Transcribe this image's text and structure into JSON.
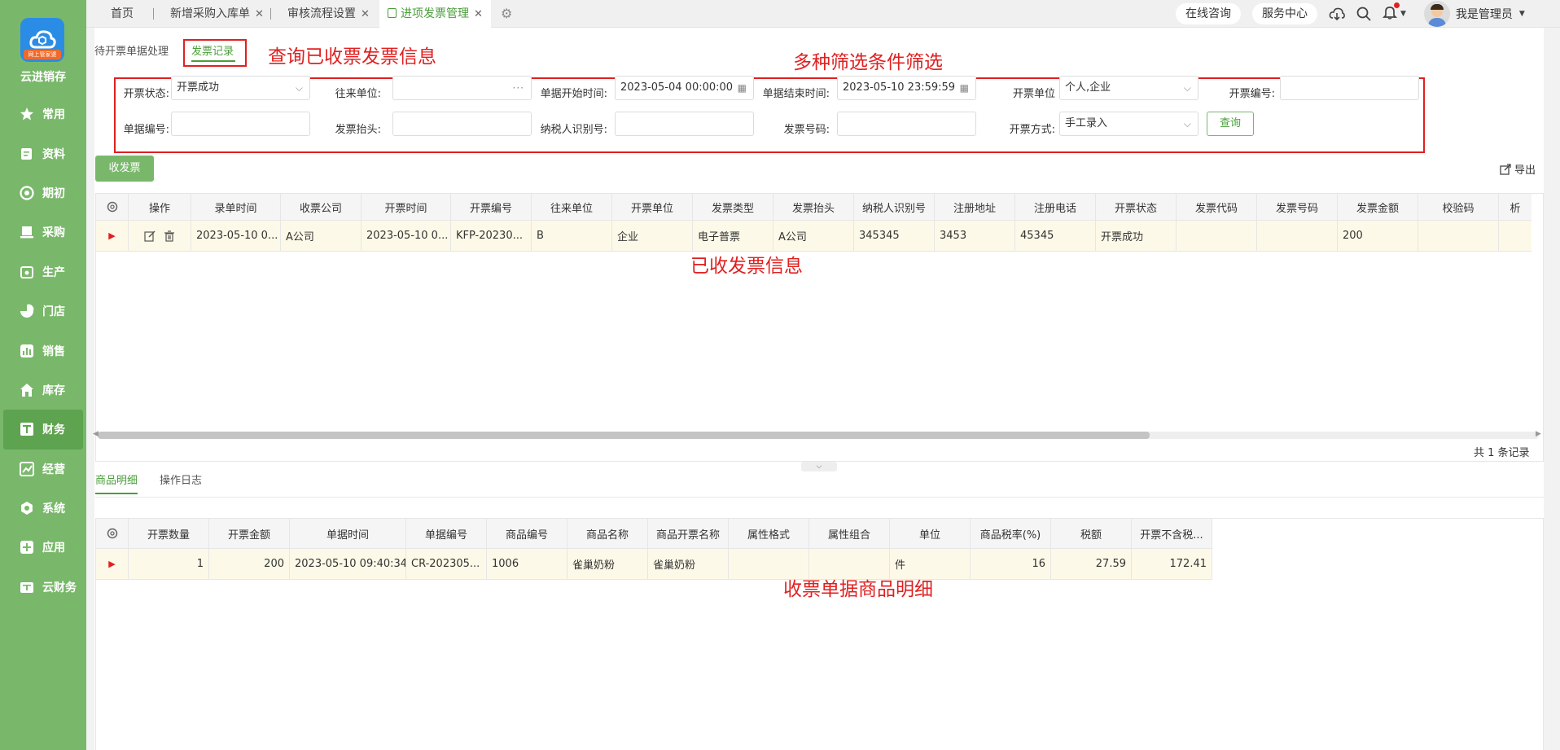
{
  "sidebar": {
    "logo_badge": "网上管家婆",
    "brand": "云进销存",
    "items": [
      {
        "label": "常用",
        "icon": "star-icon"
      },
      {
        "label": "资料",
        "icon": "document-icon"
      },
      {
        "label": "期初",
        "icon": "target-icon"
      },
      {
        "label": "采购",
        "icon": "purchase-icon"
      },
      {
        "label": "生产",
        "icon": "production-icon"
      },
      {
        "label": "门店",
        "icon": "pie-icon"
      },
      {
        "label": "销售",
        "icon": "bar-chart-icon"
      },
      {
        "label": "库存",
        "icon": "home-icon"
      },
      {
        "label": "财务",
        "icon": "finance-icon",
        "active": true
      },
      {
        "label": "经营",
        "icon": "trend-icon"
      },
      {
        "label": "系统",
        "icon": "gear-icon"
      },
      {
        "label": "应用",
        "icon": "plus-icon"
      },
      {
        "label": "云财务",
        "icon": "cloud-finance-icon"
      }
    ]
  },
  "topbar": {
    "tabs": [
      "首页",
      "新增采购入库单",
      "审核流程设置",
      "进项发票管理"
    ],
    "consult": "在线咨询",
    "service": "服务中心",
    "user": "我是管理员"
  },
  "subtabs": {
    "pending": "待开票单据处理",
    "records": "发票记录"
  },
  "annotations": {
    "a1": "查询已收票发票信息",
    "a2": "多种筛选条件筛选",
    "a3": "已收发票信息",
    "a4": "收票单据商品明细"
  },
  "filters": {
    "status_label": "开票状态:",
    "status_value": "开票成功",
    "partner_label": "往来单位:",
    "start_label": "单据开始时间:",
    "start_value": "2023-05-04 00:00:00",
    "end_label": "单据结束时间:",
    "end_value": "2023-05-10 23:59:59",
    "issuer_label": "开票单位",
    "issuer_value": "个人,企业",
    "invno_label": "开票编号:",
    "docno_label": "单据编号:",
    "title_label": "发票抬头:",
    "taxid_label": "纳税人识别号:",
    "invnum_label": "发票号码:",
    "method_label": "开票方式:",
    "method_value": "手工录入",
    "query": "查询"
  },
  "actions": {
    "receive": "收发票",
    "export": "导出"
  },
  "table1": {
    "headers": [
      "操作",
      "录单时间",
      "收票公司",
      "开票时间",
      "开票编号",
      "往来单位",
      "开票单位",
      "发票类型",
      "发票抬头",
      "纳税人识别号",
      "注册地址",
      "注册电话",
      "开票状态",
      "发票代码",
      "发票号码",
      "发票金额",
      "校验码",
      "析"
    ],
    "row": [
      "",
      "2023-05-10 0...",
      "A公司",
      "2023-05-10 0...",
      "KFP-20230...",
      "B",
      "企业",
      "电子普票",
      "A公司",
      "345345",
      "3453",
      "45345",
      "开票成功",
      "",
      "",
      "200",
      "",
      ""
    ],
    "total": "共 1 条记录"
  },
  "bottom_tabs": {
    "detail": "商品明细",
    "log": "操作日志"
  },
  "table2": {
    "headers": [
      "开票数量",
      "开票金额",
      "单据时间",
      "单据编号",
      "商品编号",
      "商品名称",
      "商品开票名称",
      "属性格式",
      "属性组合",
      "单位",
      "商品税率(%)",
      "税额",
      "开票不含税..."
    ],
    "row": [
      "1",
      "200",
      "2023-05-10 09:40:34",
      "CR-202305...",
      "1006",
      "雀巢奶粉",
      "雀巢奶粉",
      "",
      "",
      "件",
      "16",
      "27.59",
      "172.41"
    ]
  }
}
